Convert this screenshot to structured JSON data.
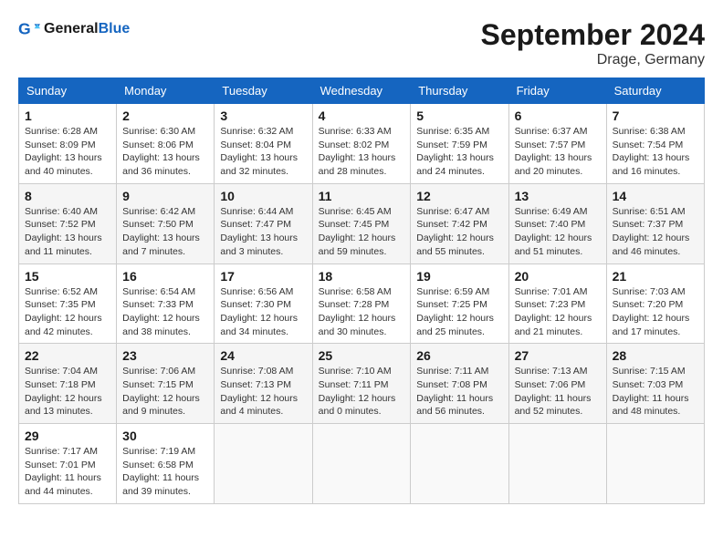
{
  "header": {
    "logo_line1": "General",
    "logo_line2": "Blue",
    "month_title": "September 2024",
    "location": "Drage, Germany"
  },
  "days_of_week": [
    "Sunday",
    "Monday",
    "Tuesday",
    "Wednesday",
    "Thursday",
    "Friday",
    "Saturday"
  ],
  "weeks": [
    [
      {
        "day": "1",
        "sunrise": "6:28 AM",
        "sunset": "8:09 PM",
        "daylight": "13 hours and 40 minutes."
      },
      {
        "day": "2",
        "sunrise": "6:30 AM",
        "sunset": "8:06 PM",
        "daylight": "13 hours and 36 minutes."
      },
      {
        "day": "3",
        "sunrise": "6:32 AM",
        "sunset": "8:04 PM",
        "daylight": "13 hours and 32 minutes."
      },
      {
        "day": "4",
        "sunrise": "6:33 AM",
        "sunset": "8:02 PM",
        "daylight": "13 hours and 28 minutes."
      },
      {
        "day": "5",
        "sunrise": "6:35 AM",
        "sunset": "7:59 PM",
        "daylight": "13 hours and 24 minutes."
      },
      {
        "day": "6",
        "sunrise": "6:37 AM",
        "sunset": "7:57 PM",
        "daylight": "13 hours and 20 minutes."
      },
      {
        "day": "7",
        "sunrise": "6:38 AM",
        "sunset": "7:54 PM",
        "daylight": "13 hours and 16 minutes."
      }
    ],
    [
      {
        "day": "8",
        "sunrise": "6:40 AM",
        "sunset": "7:52 PM",
        "daylight": "13 hours and 11 minutes."
      },
      {
        "day": "9",
        "sunrise": "6:42 AM",
        "sunset": "7:50 PM",
        "daylight": "13 hours and 7 minutes."
      },
      {
        "day": "10",
        "sunrise": "6:44 AM",
        "sunset": "7:47 PM",
        "daylight": "13 hours and 3 minutes."
      },
      {
        "day": "11",
        "sunrise": "6:45 AM",
        "sunset": "7:45 PM",
        "daylight": "12 hours and 59 minutes."
      },
      {
        "day": "12",
        "sunrise": "6:47 AM",
        "sunset": "7:42 PM",
        "daylight": "12 hours and 55 minutes."
      },
      {
        "day": "13",
        "sunrise": "6:49 AM",
        "sunset": "7:40 PM",
        "daylight": "12 hours and 51 minutes."
      },
      {
        "day": "14",
        "sunrise": "6:51 AM",
        "sunset": "7:37 PM",
        "daylight": "12 hours and 46 minutes."
      }
    ],
    [
      {
        "day": "15",
        "sunrise": "6:52 AM",
        "sunset": "7:35 PM",
        "daylight": "12 hours and 42 minutes."
      },
      {
        "day": "16",
        "sunrise": "6:54 AM",
        "sunset": "7:33 PM",
        "daylight": "12 hours and 38 minutes."
      },
      {
        "day": "17",
        "sunrise": "6:56 AM",
        "sunset": "7:30 PM",
        "daylight": "12 hours and 34 minutes."
      },
      {
        "day": "18",
        "sunrise": "6:58 AM",
        "sunset": "7:28 PM",
        "daylight": "12 hours and 30 minutes."
      },
      {
        "day": "19",
        "sunrise": "6:59 AM",
        "sunset": "7:25 PM",
        "daylight": "12 hours and 25 minutes."
      },
      {
        "day": "20",
        "sunrise": "7:01 AM",
        "sunset": "7:23 PM",
        "daylight": "12 hours and 21 minutes."
      },
      {
        "day": "21",
        "sunrise": "7:03 AM",
        "sunset": "7:20 PM",
        "daylight": "12 hours and 17 minutes."
      }
    ],
    [
      {
        "day": "22",
        "sunrise": "7:04 AM",
        "sunset": "7:18 PM",
        "daylight": "12 hours and 13 minutes."
      },
      {
        "day": "23",
        "sunrise": "7:06 AM",
        "sunset": "7:15 PM",
        "daylight": "12 hours and 9 minutes."
      },
      {
        "day": "24",
        "sunrise": "7:08 AM",
        "sunset": "7:13 PM",
        "daylight": "12 hours and 4 minutes."
      },
      {
        "day": "25",
        "sunrise": "7:10 AM",
        "sunset": "7:11 PM",
        "daylight": "12 hours and 0 minutes."
      },
      {
        "day": "26",
        "sunrise": "7:11 AM",
        "sunset": "7:08 PM",
        "daylight": "11 hours and 56 minutes."
      },
      {
        "day": "27",
        "sunrise": "7:13 AM",
        "sunset": "7:06 PM",
        "daylight": "11 hours and 52 minutes."
      },
      {
        "day": "28",
        "sunrise": "7:15 AM",
        "sunset": "7:03 PM",
        "daylight": "11 hours and 48 minutes."
      }
    ],
    [
      {
        "day": "29",
        "sunrise": "7:17 AM",
        "sunset": "7:01 PM",
        "daylight": "11 hours and 44 minutes."
      },
      {
        "day": "30",
        "sunrise": "7:19 AM",
        "sunset": "6:58 PM",
        "daylight": "11 hours and 39 minutes."
      },
      null,
      null,
      null,
      null,
      null
    ]
  ]
}
